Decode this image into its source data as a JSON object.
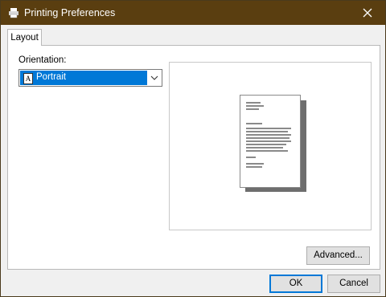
{
  "window": {
    "title": "Printing Preferences"
  },
  "tabs": [
    {
      "label": "Layout"
    }
  ],
  "orientation": {
    "label": "Orientation:",
    "selected": "Portrait"
  },
  "buttons": {
    "advanced": "Advanced...",
    "ok": "OK",
    "cancel": "Cancel"
  },
  "colors": {
    "titlebar": "#5a3e10",
    "selection": "#0078d7"
  },
  "icons": {
    "app": "printer-icon",
    "close": "close-icon",
    "dropdown": "chevron-down-icon",
    "orientation": "portrait-document-icon"
  }
}
